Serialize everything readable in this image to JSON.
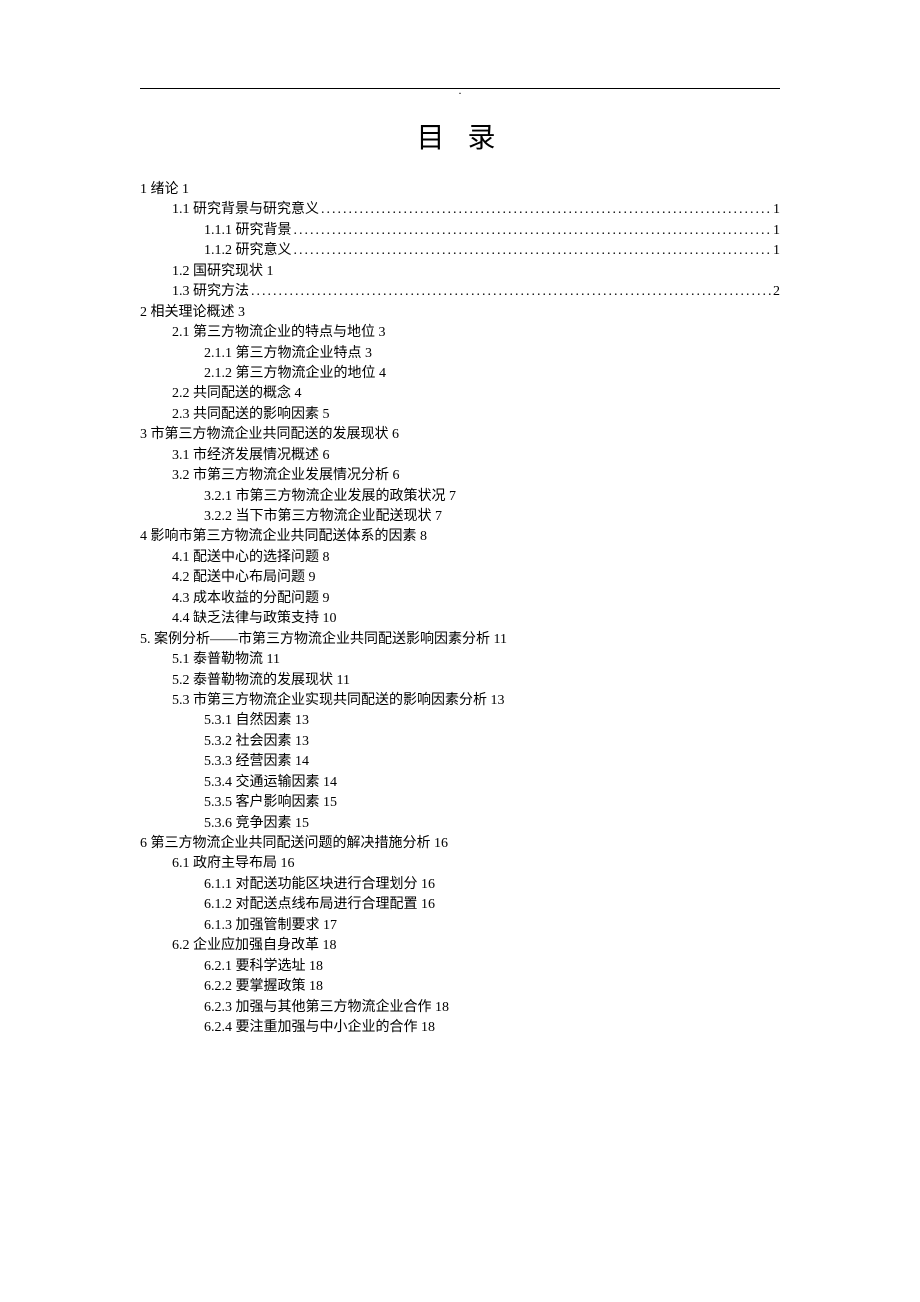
{
  "header_mark": ".",
  "title": "目 录",
  "toc": [
    {
      "level": 0,
      "text": "1 绪论 1",
      "dotted": false
    },
    {
      "level": 1,
      "text": "1.1 研究背景与研究意义",
      "page": "1",
      "dotted": true
    },
    {
      "level": 2,
      "text": "1.1.1 研究背景",
      "page": "1",
      "dotted": true
    },
    {
      "level": 2,
      "text": "1.1.2 研究意义",
      "page": "1",
      "dotted": true
    },
    {
      "level": 1,
      "text": "1.2 国研究现状 1",
      "dotted": false
    },
    {
      "level": 1,
      "text": "1.3 研究方法",
      "page": "2",
      "dotted": true
    },
    {
      "level": 0,
      "text": "2 相关理论概述 3",
      "dotted": false
    },
    {
      "level": 1,
      "text": "2.1 第三方物流企业的特点与地位 3",
      "dotted": false
    },
    {
      "level": 2,
      "text": "2.1.1 第三方物流企业特点 3",
      "dotted": false
    },
    {
      "level": 2,
      "text": "2.1.2 第三方物流企业的地位 4",
      "dotted": false
    },
    {
      "level": 1,
      "text": "2.2 共同配送的概念 4",
      "dotted": false
    },
    {
      "level": 1,
      "text": "2.3 共同配送的影响因素 5",
      "dotted": false
    },
    {
      "level": 0,
      "text": "3 市第三方物流企业共同配送的发展现状 6",
      "dotted": false
    },
    {
      "level": 1,
      "text": "3.1 市经济发展情况概述 6",
      "dotted": false
    },
    {
      "level": 1,
      "text": "3.2 市第三方物流企业发展情况分析 6",
      "dotted": false
    },
    {
      "level": 2,
      "text": "3.2.1 市第三方物流企业发展的政策状况 7",
      "dotted": false
    },
    {
      "level": 2,
      "text": "3.2.2 当下市第三方物流企业配送现状 7",
      "dotted": false
    },
    {
      "level": 0,
      "text": "4 影响市第三方物流企业共同配送体系的因素 8",
      "dotted": false
    },
    {
      "level": 1,
      "text": "4.1 配送中心的选择问题 8",
      "dotted": false
    },
    {
      "level": 1,
      "text": "4.2 配送中心布局问题 9",
      "dotted": false
    },
    {
      "level": 1,
      "text": "4.3 成本收益的分配问题 9",
      "dotted": false
    },
    {
      "level": 1,
      "text": "4.4 缺乏法律与政策支持 10",
      "dotted": false
    },
    {
      "level": 0,
      "text": "5.  案例分析——市第三方物流企业共同配送影响因素分析 11",
      "dotted": false
    },
    {
      "level": 1,
      "text": "5.1 泰普勒物流 11",
      "dotted": false
    },
    {
      "level": 1,
      "text": "5.2 泰普勒物流的发展现状 11",
      "dotted": false
    },
    {
      "level": 1,
      "text": "5.3 市第三方物流企业实现共同配送的影响因素分析 13",
      "dotted": false
    },
    {
      "level": 2,
      "text": "5.3.1 自然因素 13",
      "dotted": false
    },
    {
      "level": 2,
      "text": "5.3.2 社会因素 13",
      "dotted": false
    },
    {
      "level": 2,
      "text": "5.3.3 经营因素 14",
      "dotted": false
    },
    {
      "level": 2,
      "text": "5.3.4 交通运输因素 14",
      "dotted": false
    },
    {
      "level": 2,
      "text": "5.3.5 客户影响因素 15",
      "dotted": false
    },
    {
      "level": 2,
      "text": "5.3.6 竞争因素 15",
      "dotted": false
    },
    {
      "level": 0,
      "text": "6 第三方物流企业共同配送问题的解决措施分析 16",
      "dotted": false
    },
    {
      "level": 1,
      "text": "6.1 政府主导布局 16",
      "dotted": false
    },
    {
      "level": 2,
      "text": "6.1.1 对配送功能区块进行合理划分 16",
      "dotted": false
    },
    {
      "level": 2,
      "text": "6.1.2 对配送点线布局进行合理配置 16",
      "dotted": false
    },
    {
      "level": 2,
      "text": "6.1.3 加强管制要求 17",
      "dotted": false
    },
    {
      "level": 1,
      "text": "6.2 企业应加强自身改革 18",
      "dotted": false
    },
    {
      "level": 2,
      "text": "6.2.1 要科学选址 18",
      "dotted": false
    },
    {
      "level": 2,
      "text": "6.2.2 要掌握政策 18",
      "dotted": false
    },
    {
      "level": 2,
      "text": "6.2.3 加强与其他第三方物流企业合作 18",
      "dotted": false
    },
    {
      "level": 2,
      "text": "6.2.4 要注重加强与中小企业的合作 18",
      "dotted": false
    }
  ]
}
